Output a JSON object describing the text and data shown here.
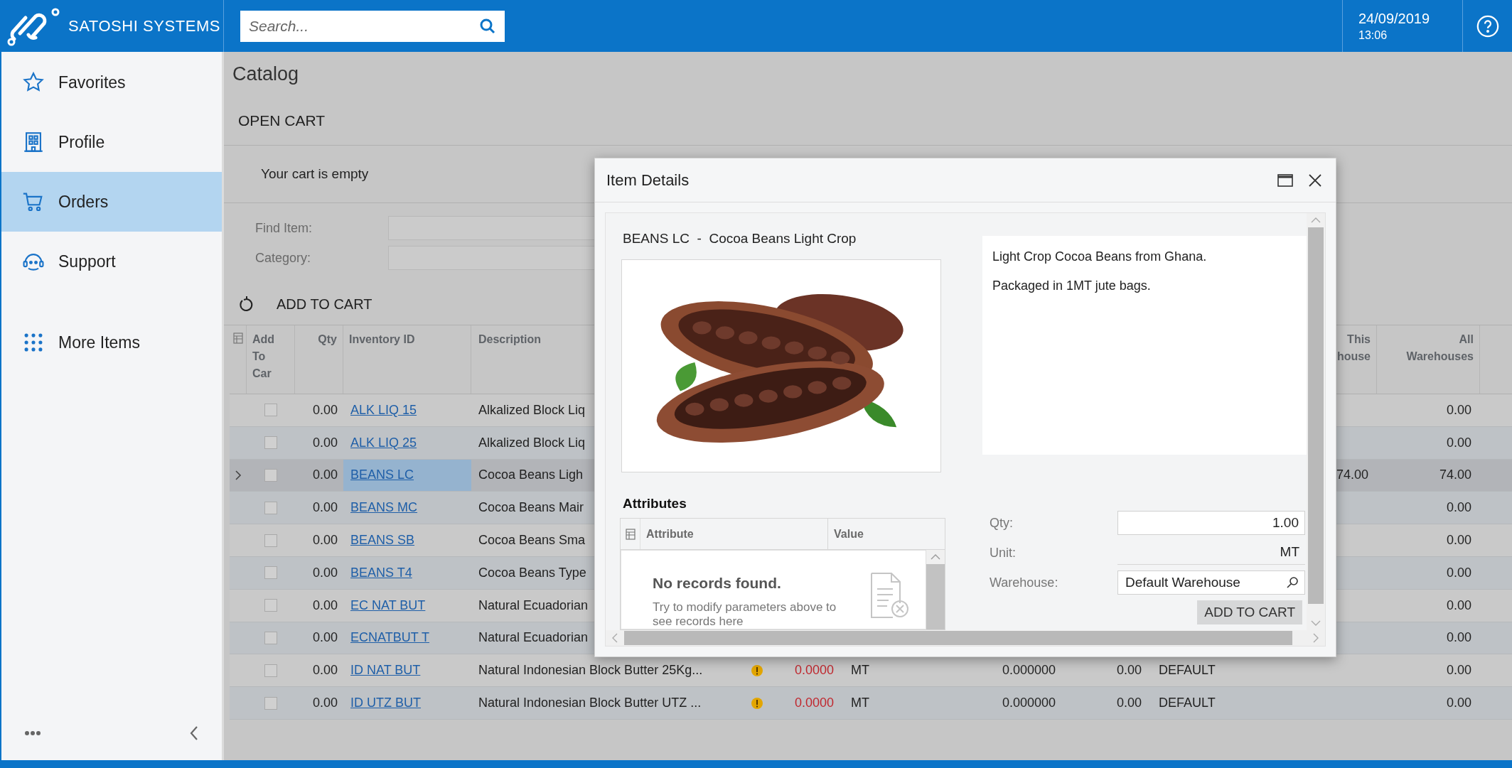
{
  "header": {
    "brand": "SATOSHI SYSTEMS",
    "search": {
      "placeholder": "Search..."
    },
    "date": "24/09/2019",
    "time": "13:06"
  },
  "sidebar": {
    "items": [
      {
        "label": "Favorites",
        "selected": false
      },
      {
        "label": "Profile",
        "selected": false
      },
      {
        "label": "Orders",
        "selected": true
      },
      {
        "label": "Support",
        "selected": false
      },
      {
        "label": "More Items",
        "selected": false
      }
    ]
  },
  "page": {
    "title": "Catalog",
    "open_cart": "OPEN CART",
    "cart_message": "Your cart is empty",
    "filters": [
      {
        "label": "Find Item:"
      },
      {
        "label": "Category:"
      }
    ],
    "toolbar": {
      "add_to_cart": "ADD TO CART"
    }
  },
  "table": {
    "columns": [
      "Add To Car",
      "Qty",
      "Inventory ID",
      "Description",
      "This house",
      "All Warehouses"
    ],
    "rows": [
      {
        "selected": false,
        "add_to_cart": false,
        "qty": "0.00",
        "inventory_id": "ALK LIQ 15",
        "description": "Alkalized Block Liq",
        "all_warehouses": "0.00"
      },
      {
        "selected": false,
        "add_to_cart": false,
        "qty": "0.00",
        "inventory_id": "ALK LIQ 25",
        "description": "Alkalized Block Liq",
        "all_warehouses": "0.00"
      },
      {
        "selected": true,
        "add_to_cart": false,
        "qty": "0.00",
        "inventory_id": "BEANS LC",
        "description": "Cocoa Beans Ligh",
        "this_warehouse": "74.00",
        "all_warehouses": "74.00"
      },
      {
        "selected": false,
        "add_to_cart": false,
        "qty": "0.00",
        "inventory_id": "BEANS MC",
        "description": "Cocoa Beans Mair",
        "all_warehouses": "0.00"
      },
      {
        "selected": false,
        "add_to_cart": false,
        "qty": "0.00",
        "inventory_id": "BEANS SB",
        "description": "Cocoa Beans Sma",
        "all_warehouses": "0.00"
      },
      {
        "selected": false,
        "add_to_cart": false,
        "qty": "0.00",
        "inventory_id": "BEANS T4",
        "description": "Cocoa Beans Type",
        "all_warehouses": "0.00"
      },
      {
        "selected": false,
        "add_to_cart": false,
        "qty": "0.00",
        "inventory_id": "EC NAT BUT",
        "description": "Natural Ecuadorian",
        "all_warehouses": "0.00"
      },
      {
        "selected": false,
        "add_to_cart": false,
        "qty": "0.00",
        "inventory_id": "ECNATBUT T",
        "description": "Natural Ecuadorian",
        "all_warehouses": "0.00"
      },
      {
        "selected": false,
        "add_to_cart": false,
        "qty": "0.00",
        "inventory_id": "ID NAT BUT",
        "description": "Natural Indonesian Block Butter 25Kg...",
        "warning": true,
        "column_7": "0.0000",
        "column_8": "MT",
        "column_9": "0.000000",
        "column_10": "0.00",
        "column_11": "DEFAULT",
        "all_warehouses": "0.00"
      },
      {
        "selected": false,
        "add_to_cart": false,
        "qty": "0.00",
        "inventory_id": "ID UTZ BUT",
        "description": "Natural Indonesian Block Butter UTZ ...",
        "warning": true,
        "column_7": "0.0000",
        "column_8": "MT",
        "column_9": "0.000000",
        "column_10": "0.00",
        "column_11": "DEFAULT",
        "all_warehouses": "0.00"
      }
    ]
  },
  "dialog": {
    "title": "Item Details",
    "item_heading": "BEANS LC  -  Cocoa Beans Light Crop",
    "description": [
      "Light Crop Cocoa Beans from Ghana.",
      "Packaged in 1MT jute bags."
    ],
    "attributes": {
      "title": "Attributes",
      "columns": [
        "Attribute",
        "Value"
      ],
      "empty_title": "No records found.",
      "empty_hint": "Try to modify parameters above to see records here"
    },
    "form": {
      "qty_label": "Qty:",
      "qty": "1.00",
      "unit_label": "Unit:",
      "unit": "MT",
      "warehouse_label": "Warehouse:",
      "warehouse": "Default Warehouse",
      "add_to_cart": "ADD TO CART"
    }
  }
}
